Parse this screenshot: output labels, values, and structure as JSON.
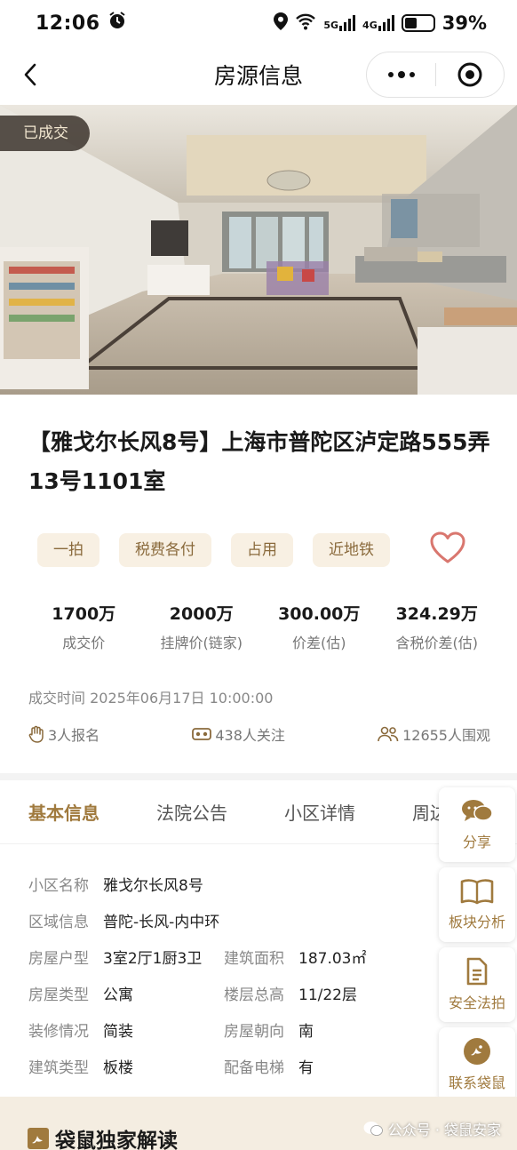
{
  "status_bar": {
    "time": "12:06",
    "network_1": "5G",
    "network_2": "4G",
    "battery_percent": "39%",
    "battery_level": 0.39
  },
  "nav": {
    "title": "房源信息"
  },
  "listing": {
    "status_badge": "已成交",
    "title": "【雅戈尔长风8号】上海市普陀区泸定路555弄13号1101室",
    "tags": [
      "一拍",
      "税费各付",
      "占用",
      "近地铁"
    ],
    "stats": [
      {
        "value": "1700万",
        "label": "成交价"
      },
      {
        "value": "2000万",
        "label": "挂牌价(链家)"
      },
      {
        "value": "300.00万",
        "label": "价差(估)"
      },
      {
        "value": "324.29万",
        "label": "含税价差(估)"
      }
    ],
    "deal_time": "成交时间 2025年06月17日 10:00:00",
    "metrics": {
      "registrations": "3人报名",
      "followers": "438人关注",
      "viewers": "12655人围观"
    }
  },
  "tabs": [
    "基本信息",
    "法院公告",
    "小区详情",
    "周边配套"
  ],
  "basic_info": {
    "community_label": "小区名称",
    "community": "雅戈尔长风8号",
    "region_label": "区域信息",
    "region": "普陀-长风-内中环",
    "layout_label": "房屋户型",
    "layout": "3室2厅1厨3卫",
    "area_label": "建筑面积",
    "area": "187.03㎡",
    "type_label": "房屋类型",
    "type": "公寓",
    "floor_label": "楼层总高",
    "floor": "11/22层",
    "decoration_label": "装修情况",
    "decoration": "简装",
    "orientation_label": "房屋朝向",
    "orientation": "南",
    "building_label": "建筑类型",
    "building": "板楼",
    "elevator_label": "配备电梯",
    "elevator": "有"
  },
  "float_actions": [
    "分享",
    "板块分析",
    "安全法拍",
    "联系袋鼠"
  ],
  "footer": {
    "section_title": "袋鼠独家解读",
    "watermark": "公众号 · 袋鼠安家"
  },
  "colors": {
    "accent": "#a07a3e",
    "tag_bg": "#f8f0e3",
    "heart": "#d9776f"
  }
}
